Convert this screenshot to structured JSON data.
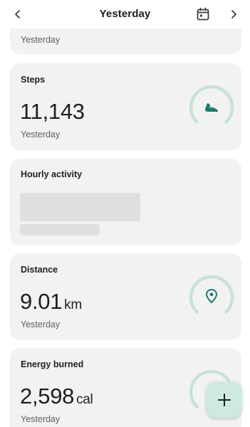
{
  "header": {
    "title": "Yesterday"
  },
  "partial_card": {
    "sub": "Yesterday"
  },
  "steps": {
    "label": "Steps",
    "value": "11,143",
    "sub": "Yesterday"
  },
  "hourly": {
    "label": "Hourly activity"
  },
  "distance": {
    "label": "Distance",
    "value": "9.01",
    "unit": "km",
    "sub": "Yesterday"
  },
  "energy": {
    "label": "Energy burned",
    "value": "2,598",
    "unit": "cal",
    "sub": "Yesterday"
  },
  "colors": {
    "accent": "#1b7a6c",
    "ring": "#c7e1dc",
    "card": "#f2f3f1",
    "fab": "#cde9e2"
  },
  "icons": {
    "prev": "chevron-left-icon",
    "next": "chevron-right-icon",
    "calendar": "calendar-icon",
    "steps": "shoe-icon",
    "distance": "location-pin-icon",
    "add": "plus-icon"
  }
}
